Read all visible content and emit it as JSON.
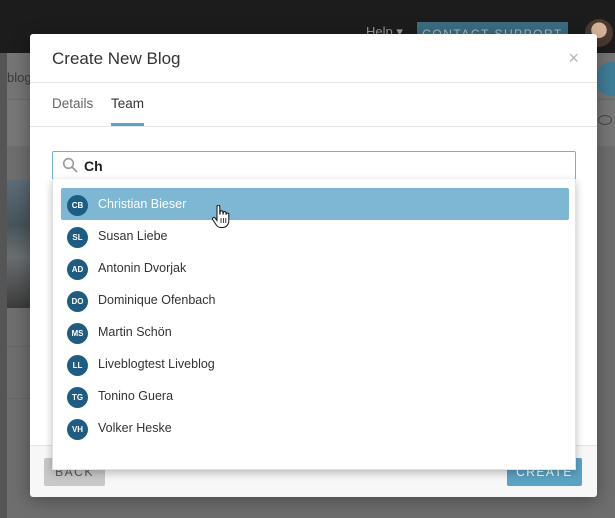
{
  "background": {
    "help_label": "Help ▾",
    "contact_label": "CONTACT SUPPORT",
    "sidebar_text": "blog"
  },
  "modal": {
    "title": "Create New Blog",
    "close_icon": "×",
    "tabs": [
      {
        "label": "Details",
        "active": false
      },
      {
        "label": "Team",
        "active": true
      }
    ],
    "search": {
      "icon": "search-icon",
      "value": "Ch"
    },
    "options": [
      {
        "initials": "CB",
        "name": "Christian Bieser",
        "highlighted": true
      },
      {
        "initials": "SL",
        "name": "Susan Liebe",
        "highlighted": false
      },
      {
        "initials": "AD",
        "name": "Antonin Dvorjak",
        "highlighted": false
      },
      {
        "initials": "DO",
        "name": "Dominique Ofenbach",
        "highlighted": false
      },
      {
        "initials": "MS",
        "name": "Martin Schön",
        "highlighted": false
      },
      {
        "initials": "LL",
        "name": "Liveblogtest Liveblog",
        "highlighted": false
      },
      {
        "initials": "TG",
        "name": "Tonino Guera",
        "highlighted": false
      },
      {
        "initials": "VH",
        "name": "Volker Heske",
        "highlighted": false
      }
    ],
    "footer": {
      "back_label": "BACK",
      "create_label": "CREATE"
    }
  },
  "colors": {
    "accent": "#58a4c7",
    "highlight": "#7db7d4",
    "avatar": "#1f5c82",
    "create_button": "#5aa3c3"
  }
}
